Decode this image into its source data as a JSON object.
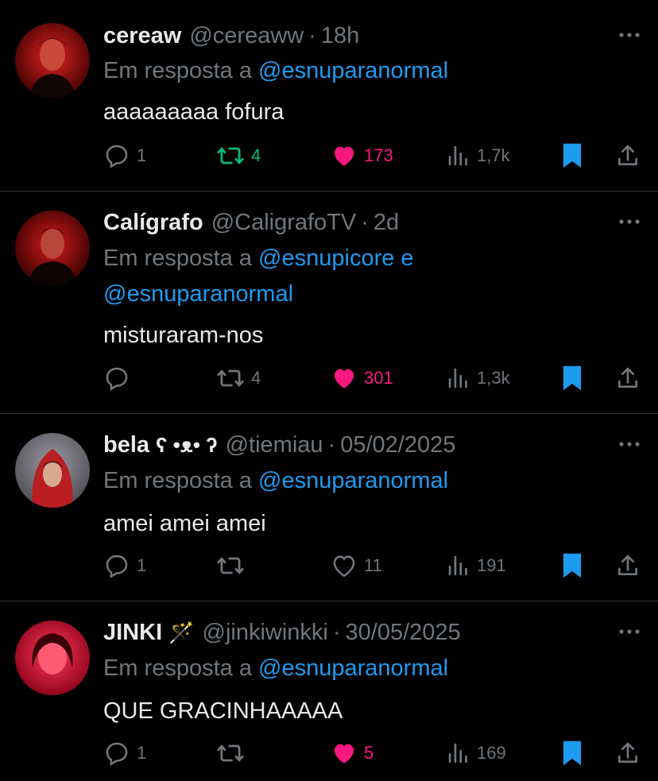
{
  "tweets": [
    {
      "name": "cereaw",
      "badge": "",
      "handle": "@cereaww",
      "time": "18h",
      "reply_prefix": "Em resposta a",
      "mentions_line1": "@esnuparanormal",
      "mentions_line2": "",
      "text": "aaaaaaaaa fofura",
      "replies": "1",
      "retweets": "4",
      "retweeted": true,
      "likes": "173",
      "liked": true,
      "views": "1,7k"
    },
    {
      "name": "Calígrafo",
      "badge": "",
      "handle": "@CaligrafoTV",
      "time": "2d",
      "reply_prefix": "Em resposta a",
      "mentions_line1": "@esnupicore e",
      "mentions_line2": "@esnuparanormal",
      "text": "misturaram-nos",
      "replies": "",
      "retweets": "4",
      "retweeted": false,
      "likes": "301",
      "liked": true,
      "views": "1,3k"
    },
    {
      "name": "bela",
      "badge": "ʕ •ᴥ• ʔ",
      "handle": "@tiemiau",
      "time": "05/02/2025",
      "reply_prefix": "Em resposta a",
      "mentions_line1": "@esnuparanormal",
      "mentions_line2": "",
      "text": "amei amei amei",
      "replies": "1",
      "retweets": "",
      "retweeted": false,
      "likes": "11",
      "liked": false,
      "views": "191"
    },
    {
      "name": "JINKI",
      "badge": "🪄",
      "handle": "@jinkiwinkki",
      "time": "30/05/2025",
      "reply_prefix": "Em resposta a",
      "mentions_line1": "@esnuparanormal",
      "mentions_line2": "",
      "text": "QUE GRACINHAAAAA",
      "replies": "1",
      "retweets": "",
      "retweeted": false,
      "likes": "5",
      "liked": true,
      "views": "169"
    }
  ],
  "colors": {
    "background": "#000000",
    "text": "#e7e9ea",
    "muted": "#71767b",
    "mention": "#1d9bf0",
    "like": "#f91880",
    "retweet": "#00ba7c",
    "bookmark": "#1d9bf0",
    "divider": "#2f3336"
  },
  "icons": [
    "reply-icon",
    "retweet-icon",
    "heart-icon",
    "views-icon",
    "bookmark-icon",
    "share-icon",
    "more-icon"
  ]
}
